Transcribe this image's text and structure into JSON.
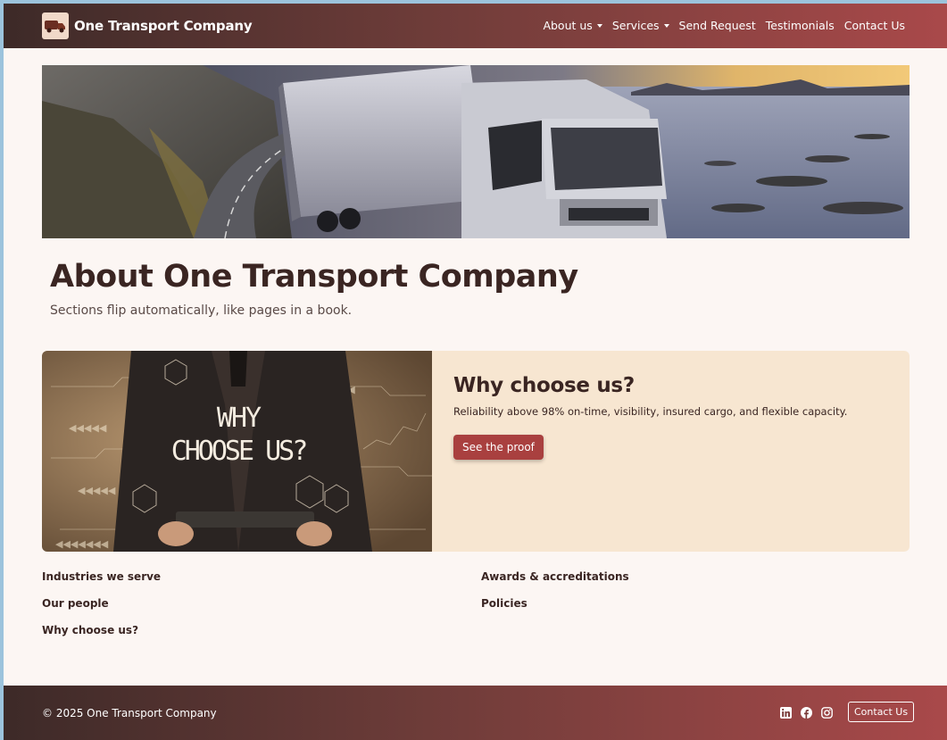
{
  "brand": {
    "name": "One Transport Company",
    "logo_icon": "truck-logo-icon"
  },
  "nav": {
    "items": [
      {
        "label": "About us",
        "dropdown": true
      },
      {
        "label": "Services",
        "dropdown": true
      },
      {
        "label": "Send Request",
        "dropdown": false
      },
      {
        "label": "Testimonials",
        "dropdown": false
      },
      {
        "label": "Contact Us",
        "dropdown": false
      }
    ]
  },
  "hero": {
    "image": "truck-on-coastal-road"
  },
  "page": {
    "title": "About One Transport Company",
    "subtitle": "Sections flip automatically, like pages in a book."
  },
  "card": {
    "image_caption": "WHY CHOOSE US?",
    "title": "Why choose us?",
    "text": "Reliability above 98% on-time, visibility, insured cargo, and flexible capacity.",
    "button": "See the proof"
  },
  "section_links": {
    "left": [
      "Industries we serve",
      "Our people",
      "Why choose us?"
    ],
    "right": [
      "Awards & accreditations",
      "Policies"
    ]
  },
  "footer": {
    "copyright": "© 2025 One Transport Company",
    "social_icons": [
      "linkedin-icon",
      "facebook-icon",
      "instagram-icon"
    ],
    "contact_button": "Contact Us"
  },
  "colors": {
    "accent": "#a9403f",
    "card_bg": "#f7e6d1",
    "page_bg": "#fcf6f3",
    "text_dark": "#3a2522"
  }
}
